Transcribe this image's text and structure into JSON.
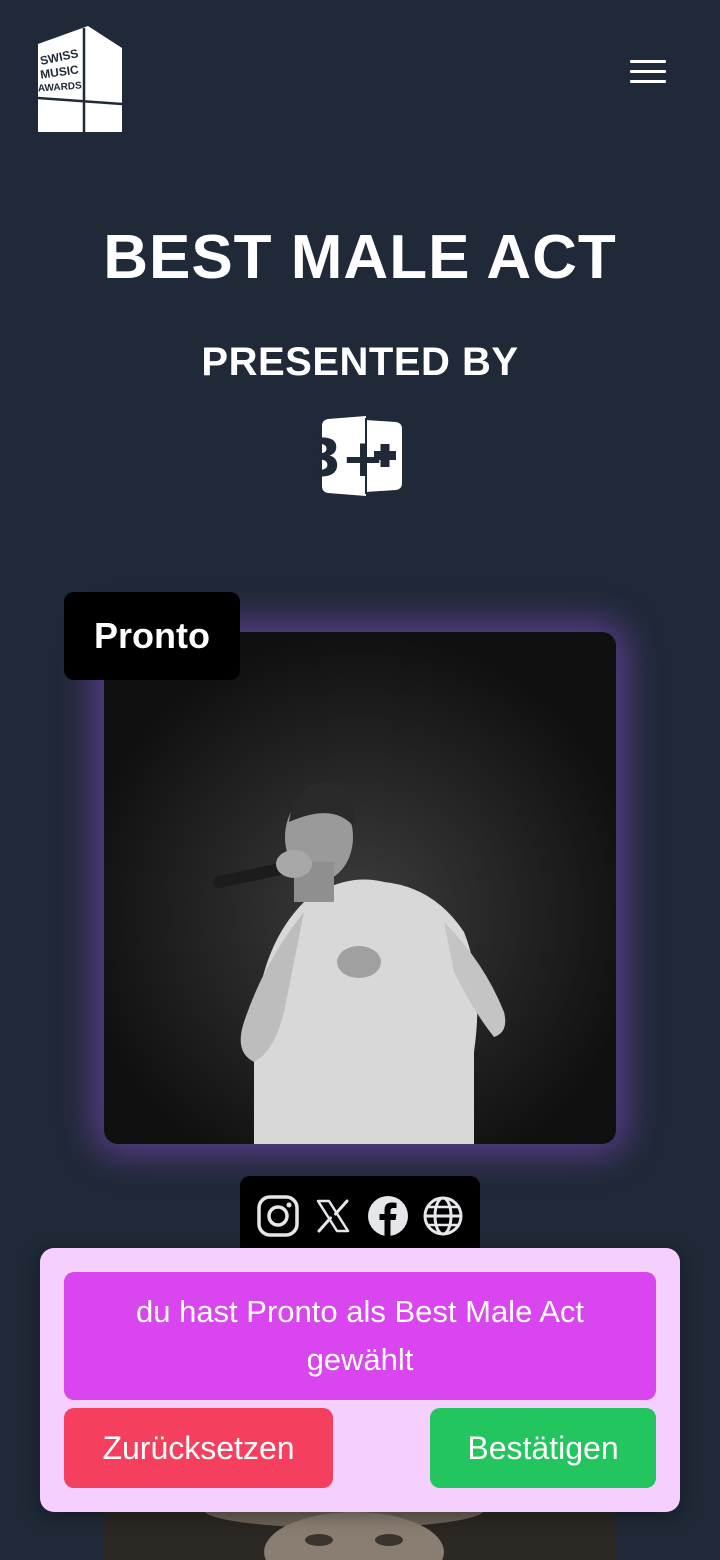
{
  "header": {
    "logo_lines": [
      "SWISS",
      "MUSIC",
      "AWARDS"
    ],
    "menu_icon": "hamburger-menu-icon"
  },
  "category": {
    "title": "BEST MALE ACT",
    "presented_by": "PRESENTED BY",
    "sponsor_logo": "3+"
  },
  "nominee": {
    "name": "Pronto",
    "social_icons": [
      "instagram-icon",
      "x-icon",
      "facebook-icon",
      "globe-icon"
    ]
  },
  "vote_panel": {
    "message": "du hast Pronto als Best Male Act gewählt",
    "reset_label": "Zurücksetzen",
    "confirm_label": "Bestätigen"
  },
  "colors": {
    "background": "#1f2937",
    "panel": "#f5d0fe",
    "message": "#d946ef",
    "reset": "#f43f5e",
    "confirm": "#22c55e",
    "glow": "#a855f7"
  }
}
